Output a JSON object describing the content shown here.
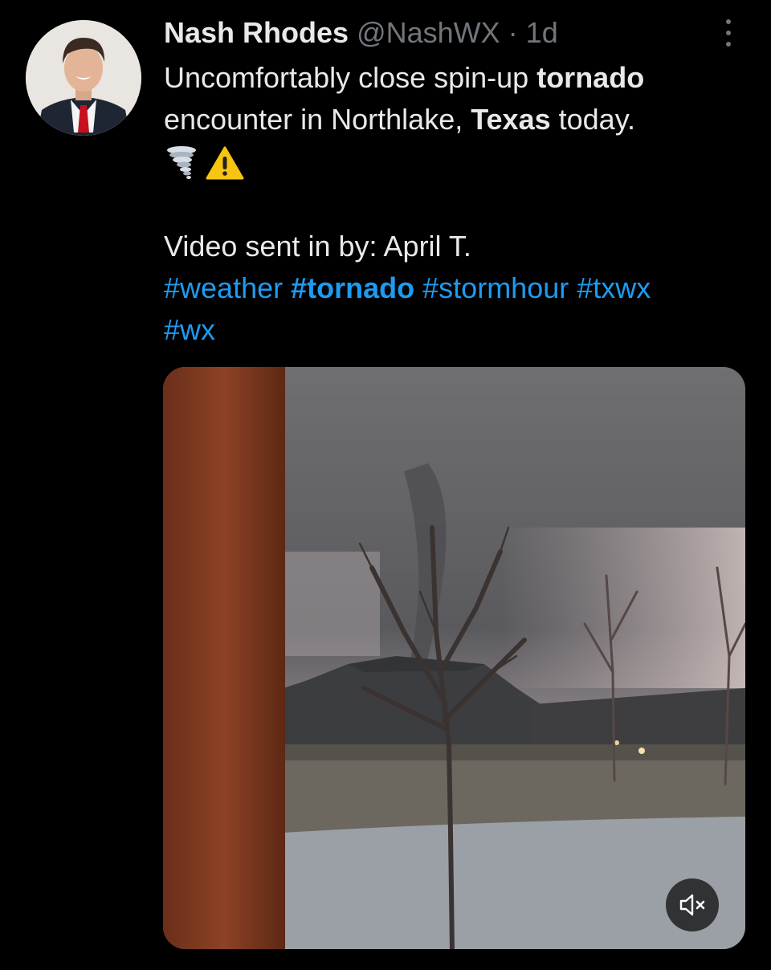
{
  "tweet": {
    "author": {
      "name": "Nash Rhodes",
      "handle": "@NashWX"
    },
    "separator": "·",
    "time": "1d",
    "text": {
      "l1a": "Uncomfortably close spin-up ",
      "l1b": "tornado",
      "l2a": "encounter in Northlake, ",
      "l2b": "Texas",
      "l2c": " today.",
      "credit": "Video sent in by: April T."
    },
    "hashtags": [
      "#weather",
      "#tornado",
      "#stormhour",
      "#txwx",
      "#wx"
    ],
    "emojis": [
      "tornado-emoji",
      "warning-emoji"
    ],
    "media": {
      "type": "video",
      "muted": true
    }
  },
  "colors": {
    "background": "#000000",
    "text": "#e7e9ea",
    "muted": "#71767b",
    "link": "#1d9bf0"
  }
}
